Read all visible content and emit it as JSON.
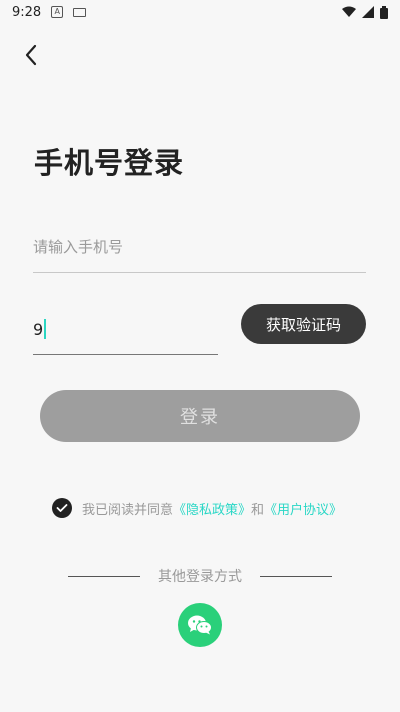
{
  "status_bar": {
    "time": "9:28"
  },
  "header": {
    "title": "手机号登录"
  },
  "form": {
    "phone_placeholder": "请输入手机号",
    "code_value": "9",
    "get_code_label": "获取验证码",
    "login_label": "登录"
  },
  "agreement": {
    "text_prefix": "我已阅读并同意",
    "privacy_link": "《隐私政策》",
    "and_text": "和",
    "user_link": "《用户协议》"
  },
  "other_login": {
    "label": "其他登录方式"
  },
  "colors": {
    "accent": "#2ad7c6",
    "wechat": "#2ad07a",
    "dark_button": "#3a3a3a"
  }
}
